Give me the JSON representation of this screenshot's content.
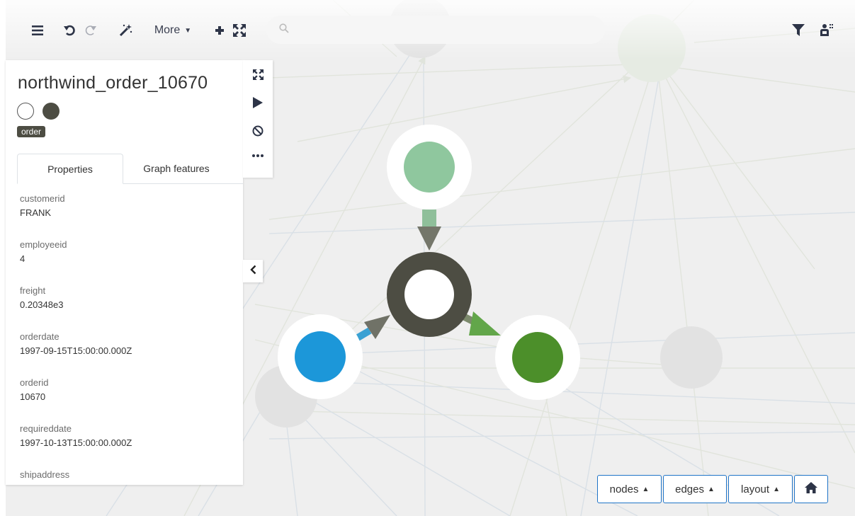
{
  "toolbar": {
    "more_label": "More",
    "more_caret": "▲",
    "search_placeholder": "",
    "icons": [
      "hamburger-icon",
      "undo-icon",
      "redo-icon",
      "magic-wand-icon",
      "collapse-icon",
      "expand-icon",
      "search-icon",
      "filter-icon",
      "person-icon"
    ]
  },
  "panel": {
    "title": "northwind_order_10670",
    "category": "order",
    "tabs": [
      "Properties",
      "Graph features"
    ],
    "properties": [
      {
        "key": "customerid",
        "value": "FRANK"
      },
      {
        "key": "employeeid",
        "value": "4"
      },
      {
        "key": "freight",
        "value": "0.20348e3"
      },
      {
        "key": "orderdate",
        "value": "1997-09-15T15:00:00.000Z"
      },
      {
        "key": "orderid",
        "value": "10670"
      },
      {
        "key": "requireddate",
        "value": "1997-10-13T15:00:00.000Z"
      },
      {
        "key": "shipaddress",
        "value": ""
      }
    ],
    "actions": [
      "expand-icon",
      "play-icon",
      "block-icon",
      "more-dots-icon"
    ],
    "collapse_icon": "chevron-left-icon"
  },
  "bottom": {
    "nodes_label": "nodes",
    "edges_label": "edges",
    "layout_label": "layout",
    "caret": "▲",
    "home_icon": "home-icon"
  },
  "colors": {
    "order_node": "#4d4d43",
    "node_light_green": "#8fc79e",
    "node_blue": "#1c97d9",
    "node_green": "#4c8f2a",
    "accent_blue": "#1f74c7"
  }
}
